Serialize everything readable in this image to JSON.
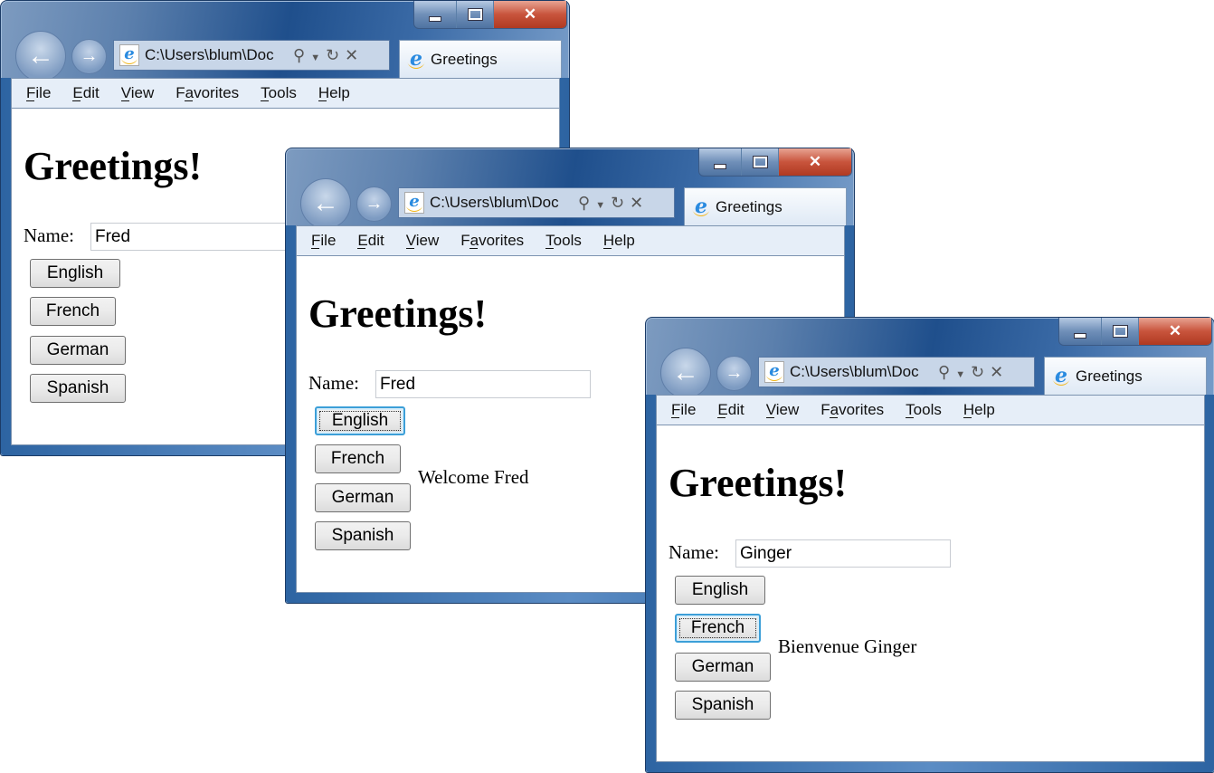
{
  "windows": [
    {
      "address": "C:\\Users\\blum\\Doc",
      "tab_title": "Greetings",
      "menu": [
        "File",
        "Edit",
        "View",
        "Favorites",
        "Tools",
        "Help"
      ],
      "heading": "Greetings!",
      "name_label": "Name:",
      "name_value": "Fred",
      "buttons": [
        "English",
        "French",
        "German",
        "Spanish"
      ],
      "focused_button": null,
      "message": ""
    },
    {
      "address": "C:\\Users\\blum\\Doc",
      "tab_title": "Greetings",
      "menu": [
        "File",
        "Edit",
        "View",
        "Favorites",
        "Tools",
        "Help"
      ],
      "heading": "Greetings!",
      "name_label": "Name:",
      "name_value": "Fred",
      "buttons": [
        "English",
        "French",
        "German",
        "Spanish"
      ],
      "focused_button": "English",
      "message": "Welcome Fred"
    },
    {
      "address": "C:\\Users\\blum\\Doc",
      "tab_title": "Greetings",
      "menu": [
        "File",
        "Edit",
        "View",
        "Favorites",
        "Tools",
        "Help"
      ],
      "heading": "Greetings!",
      "name_label": "Name:",
      "name_value": "Ginger",
      "buttons": [
        "English",
        "French",
        "German",
        "Spanish"
      ],
      "focused_button": "French",
      "message": "Bienvenue Ginger"
    }
  ],
  "icons": {
    "back": "back-arrow-icon",
    "forward": "forward-arrow-icon",
    "page": "ie-page-icon",
    "search": "search-icon",
    "refresh": "refresh-icon",
    "stop": "stop-icon",
    "minimize": "minimize-icon",
    "maximize": "maximize-icon",
    "close": "close-icon"
  },
  "colors": {
    "focus_border": "#3c9fd8",
    "menubar": "#e6eef8"
  }
}
